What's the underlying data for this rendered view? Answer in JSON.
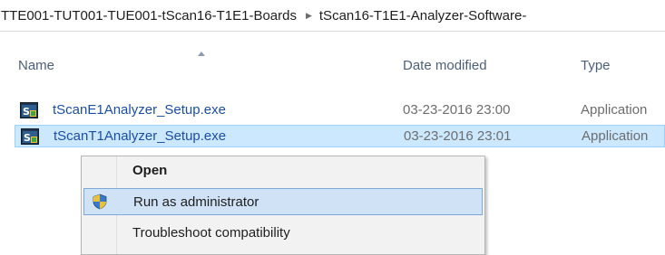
{
  "breadcrumb": {
    "items": [
      "TTE001-TUT001-TUE001-tScan16-T1E1-Boards",
      "tScan16-T1E1-Analyzer-Software-"
    ],
    "separator": "▶"
  },
  "columns": {
    "name": "Name",
    "date_modified": "Date modified",
    "type": "Type"
  },
  "files": [
    {
      "name": "tScanE1Analyzer_Setup.exe",
      "date": "03-23-2016 23:00",
      "type": "Application"
    },
    {
      "name": "tScanT1Analyzer_Setup.exe",
      "date": "03-23-2016 23:01",
      "type": "Application"
    }
  ],
  "context_menu": {
    "items": [
      {
        "label": "Open"
      },
      {
        "label": "Run as administrator",
        "icon": "uac-shield-icon"
      },
      {
        "label": "Troubleshoot compatibility"
      }
    ]
  },
  "colors": {
    "selection_bg": "#cce8ff",
    "selection_border": "#99d1ff",
    "menu_highlight_bg": "#d0e3f6",
    "menu_highlight_border": "#7ba9d8",
    "header_text": "#4c607a",
    "file_name_text": "#1b4ea8"
  }
}
